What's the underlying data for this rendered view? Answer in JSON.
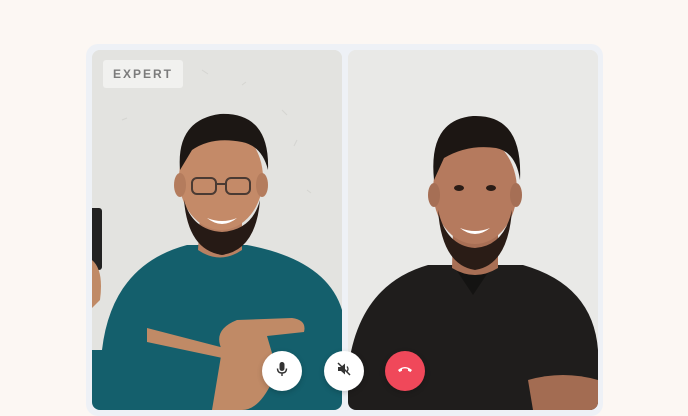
{
  "call": {
    "expert_badge": "EXPERT"
  },
  "controls": {
    "mic_icon": "microphone-icon",
    "speaker_icon": "speaker-muted-icon",
    "end_icon": "phone-hangup-icon",
    "end_color": "#f0485a"
  },
  "participants": [
    {
      "role": "expert",
      "shirt_color": "#145f6c"
    },
    {
      "role": "user",
      "shirt_color": "#1e1c1b"
    }
  ]
}
